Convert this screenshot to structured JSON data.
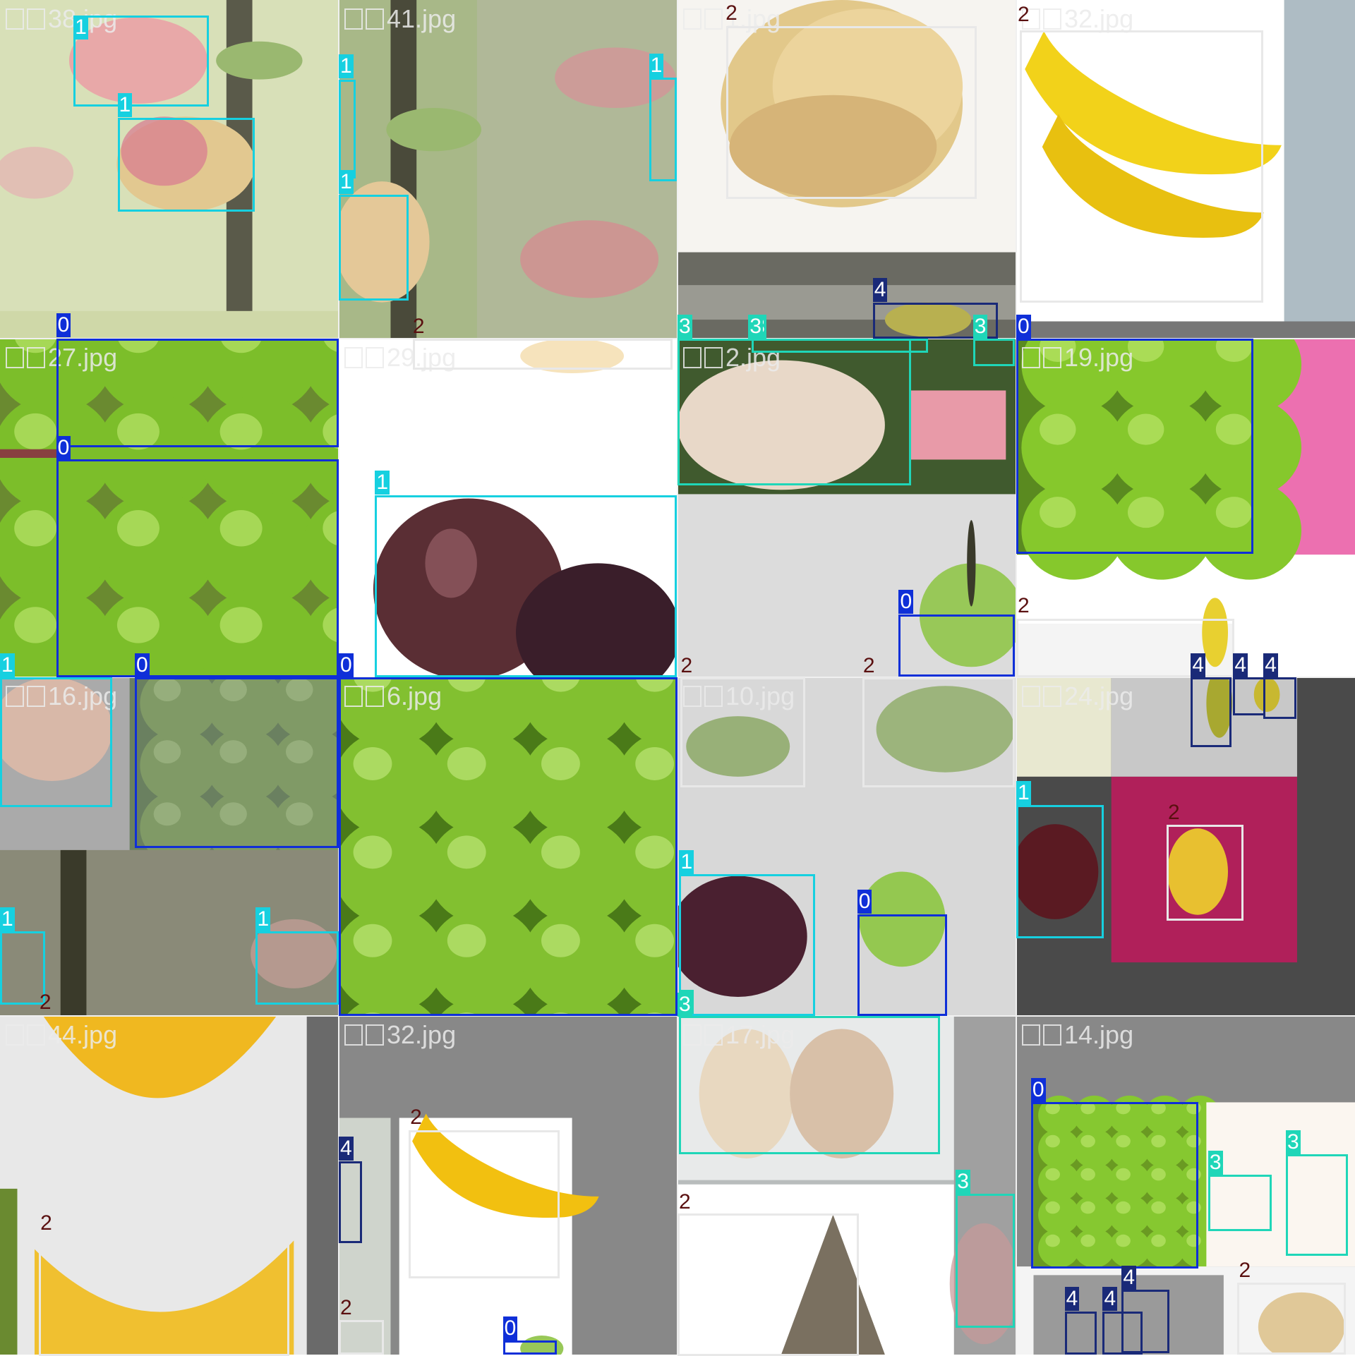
{
  "colors": {
    "class_0": "#0f2fd8",
    "class_1": "#16d0e0",
    "class_2": "#e8e8e8",
    "class_3": "#1fd6b8",
    "class_4": "#1a2a78",
    "label_2_text": "#5a1010"
  },
  "classes": [
    "0",
    "1",
    "2",
    "3",
    "4"
  ],
  "tiles": [
    {
      "name": "tile-38",
      "file": "38.jpg",
      "scene": "pink-fruit-branch"
    },
    {
      "name": "tile-41",
      "file": "41.jpg",
      "scene": "branch-blur"
    },
    {
      "name": "tile-21",
      "file": "1.jpg",
      "scene": "banana-bunch"
    },
    {
      "name": "tile-32a",
      "file": "32.jpg",
      "scene": "yellow-banana"
    },
    {
      "name": "tile-27",
      "file": "27.jpg",
      "scene": "green-apples"
    },
    {
      "name": "tile-29",
      "file": "29.jpg",
      "scene": "dark-plums"
    },
    {
      "name": "tile-2",
      "file": "2.jpg",
      "scene": "peeled-fruit"
    },
    {
      "name": "tile-19",
      "file": "19.jpg",
      "scene": "green-apples-pink"
    },
    {
      "name": "tile-16",
      "file": "16.jpg",
      "scene": "apples-mixed"
    },
    {
      "name": "tile-6",
      "file": "6.jpg",
      "scene": "green-apples-full"
    },
    {
      "name": "tile-10",
      "file": "10.jpg",
      "scene": "green-bananas"
    },
    {
      "name": "tile-24",
      "file": "24.jpg",
      "scene": "mixed-magenta"
    },
    {
      "name": "tile-44",
      "file": "44.jpg",
      "scene": "banana-large"
    },
    {
      "name": "tile-32b",
      "file": "32.jpg",
      "scene": "banana-gray"
    },
    {
      "name": "tile-17",
      "file": "17.jpg",
      "scene": "peach-tray"
    },
    {
      "name": "tile-14",
      "file": "14.jpg",
      "scene": "apple-crate"
    }
  ],
  "detections": [
    {
      "cls": "1",
      "label": "1"
    },
    {
      "cls": "1",
      "label": "1"
    },
    {
      "cls": "1",
      "label": "1"
    },
    {
      "cls": "1",
      "label": "1"
    },
    {
      "cls": "1",
      "label": "1"
    },
    {
      "cls": "2",
      "label": "2"
    },
    {
      "cls": "2",
      "label": "2"
    },
    {
      "cls": "4",
      "label": "4"
    },
    {
      "cls": "3",
      "label": "3"
    },
    {
      "cls": "3",
      "label": "3"
    },
    {
      "cls": "3",
      "label": "3"
    },
    {
      "cls": "0",
      "label": "0"
    },
    {
      "cls": "0",
      "label": "0"
    },
    {
      "cls": "2",
      "label": "2"
    },
    {
      "cls": "1",
      "label": "1"
    },
    {
      "cls": "3",
      "label": "3"
    },
    {
      "cls": "0",
      "label": "0"
    },
    {
      "cls": "0",
      "label": "0"
    },
    {
      "cls": "2",
      "label": "2"
    },
    {
      "cls": "1",
      "label": "1"
    },
    {
      "cls": "0",
      "label": "0"
    },
    {
      "cls": "1",
      "label": "1"
    },
    {
      "cls": "1",
      "label": "1"
    },
    {
      "cls": "2",
      "label": "2"
    },
    {
      "cls": "0",
      "label": "0"
    },
    {
      "cls": "2",
      "label": "2"
    },
    {
      "cls": "2",
      "label": "2"
    },
    {
      "cls": "1",
      "label": "1"
    },
    {
      "cls": "0",
      "label": "0"
    },
    {
      "cls": "3",
      "label": "3"
    },
    {
      "cls": "4",
      "label": "4"
    },
    {
      "cls": "4",
      "label": "4"
    },
    {
      "cls": "4",
      "label": "4"
    },
    {
      "cls": "1",
      "label": "1"
    },
    {
      "cls": "2",
      "label": "2"
    },
    {
      "cls": "2",
      "label": "2"
    },
    {
      "cls": "4",
      "label": "4"
    },
    {
      "cls": "2",
      "label": "2"
    },
    {
      "cls": "2",
      "label": "2"
    },
    {
      "cls": "0",
      "label": "0"
    },
    {
      "cls": "3",
      "label": "3"
    },
    {
      "cls": "2",
      "label": "2"
    },
    {
      "cls": "3",
      "label": "3"
    },
    {
      "cls": "0",
      "label": "0"
    },
    {
      "cls": "3",
      "label": "3"
    },
    {
      "cls": "3",
      "label": "3"
    },
    {
      "cls": "4",
      "label": "4"
    },
    {
      "cls": "4",
      "label": "4"
    },
    {
      "cls": "4",
      "label": "4"
    },
    {
      "cls": "2",
      "label": "2"
    }
  ]
}
